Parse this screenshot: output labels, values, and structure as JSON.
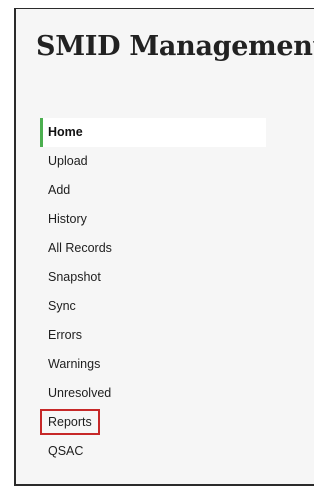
{
  "app": {
    "title": "SMID Management"
  },
  "nav": {
    "items": [
      {
        "label": "Home",
        "active": true
      },
      {
        "label": "Upload"
      },
      {
        "label": "Add"
      },
      {
        "label": "History"
      },
      {
        "label": "All Records"
      },
      {
        "label": "Snapshot"
      },
      {
        "label": "Sync"
      },
      {
        "label": "Errors"
      },
      {
        "label": "Warnings"
      },
      {
        "label": "Unresolved"
      },
      {
        "label": "Reports",
        "highlighted": true
      },
      {
        "label": "QSAC"
      }
    ]
  },
  "colors": {
    "accent": "#4caf50",
    "highlight_border": "#c62828",
    "panel_background": "#f6f6f6"
  }
}
